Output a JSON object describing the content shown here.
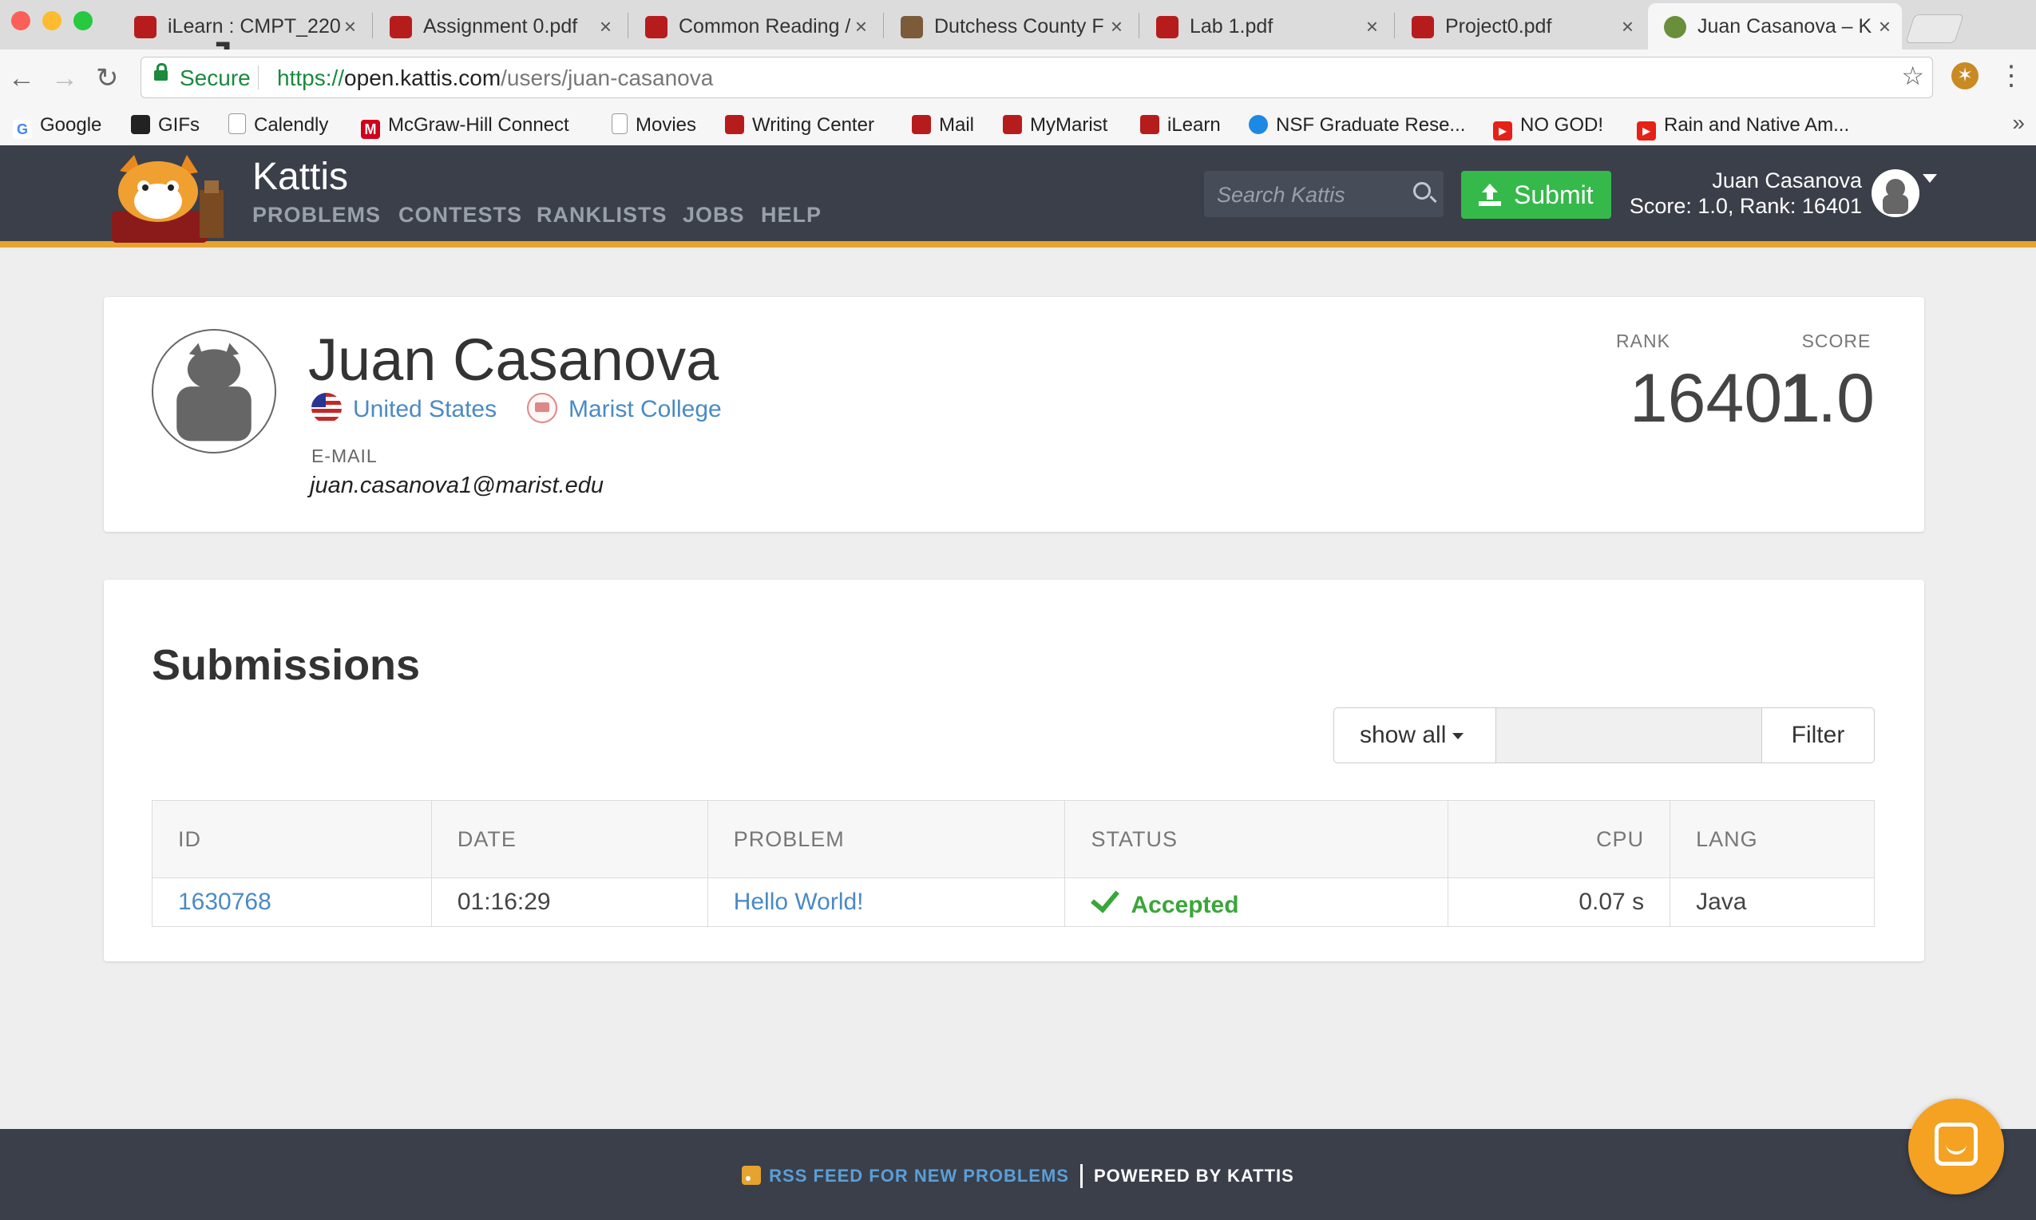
{
  "browser": {
    "tabs": [
      {
        "title": "iLearn : CMPT_220",
        "icon_color": "#b71c1c"
      },
      {
        "title": "Assignment 0.pdf",
        "icon_color": "#b71c1c"
      },
      {
        "title": "Common Reading /",
        "icon_color": "#b71c1c"
      },
      {
        "title": "Dutchess County F",
        "icon_color": "#7b5b3a"
      },
      {
        "title": "Lab 1.pdf",
        "icon_color": "#b71c1c"
      },
      {
        "title": "Project0.pdf",
        "icon_color": "#b71c1c"
      },
      {
        "title": "Juan Casanova – K",
        "icon_color": "#6a8f3a"
      }
    ],
    "profile_name": "Juan",
    "secure_label": "Secure",
    "url_scheme": "https://",
    "url_host": "open.kattis.com",
    "url_path": "/users/juan-casanova",
    "bookmarks": [
      {
        "label": "Google",
        "icon": "google-icon",
        "color": "#4285f4"
      },
      {
        "label": "GIFs",
        "icon": "gifs-icon",
        "color": "#222222"
      },
      {
        "label": "Calendly",
        "icon": "page-icon",
        "color": "#999999"
      },
      {
        "label": "McGraw-Hill Connect",
        "icon": "mcgraw-hill-icon",
        "color": "#d0021b"
      },
      {
        "label": "Movies",
        "icon": "page-icon",
        "color": "#999999"
      },
      {
        "label": "Writing Center",
        "icon": "marist-fox-icon",
        "color": "#b71c1c"
      },
      {
        "label": "Mail",
        "icon": "marist-fox-icon",
        "color": "#b71c1c"
      },
      {
        "label": "MyMarist",
        "icon": "marist-fox-icon",
        "color": "#b71c1c"
      },
      {
        "label": "iLearn",
        "icon": "marist-fox-icon",
        "color": "#b71c1c"
      },
      {
        "label": "NSF Graduate Rese...",
        "icon": "nsf-icon",
        "color": "#1e88e5"
      },
      {
        "label": "NO GOD!",
        "icon": "youtube-icon",
        "color": "#e62117"
      },
      {
        "label": "Rain and Native Am...",
        "icon": "youtube-icon",
        "color": "#e62117"
      }
    ]
  },
  "header": {
    "brand": "Kattis",
    "nav": [
      "PROBLEMS",
      "CONTESTS",
      "RANKLISTS",
      "JOBS",
      "HELP"
    ],
    "search_placeholder": "Search Kattis",
    "submit_label": "Submit",
    "user_name": "Juan Casanova",
    "user_stats": "Score: 1.0, Rank: 16401",
    "accent_color": "#e6a32e",
    "submit_color": "#34b94a"
  },
  "profile": {
    "name": "Juan Casanova",
    "country": "United States",
    "school": "Marist College",
    "email_label": "E-MAIL",
    "email": "juan.casanova1@marist.edu",
    "rank_label": "RANK",
    "rank": "16401",
    "score_label": "SCORE",
    "score": "1.0"
  },
  "submissions": {
    "title": "Submissions",
    "filter_select": "show all",
    "filter_button": "Filter",
    "columns": [
      "ID",
      "DATE",
      "PROBLEM",
      "STATUS",
      "CPU",
      "LANG"
    ],
    "rows": [
      {
        "id": "1630768",
        "date": "01:16:29",
        "problem": "Hello World!",
        "status": "Accepted",
        "cpu": "0.07 s",
        "lang": "Java"
      }
    ]
  },
  "footer": {
    "rss": "RSS FEED FOR NEW PROBLEMS",
    "powered": "POWERED BY KATTIS"
  }
}
